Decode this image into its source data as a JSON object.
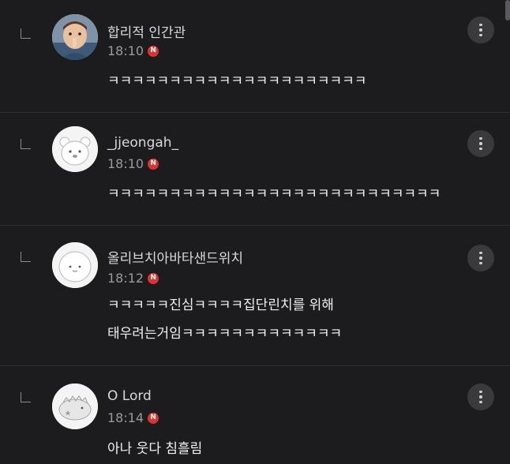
{
  "comments": [
    {
      "nickname": "합리적 인간관",
      "time": "18:10",
      "badge": "N",
      "lines": [
        "ㅋㅋㅋㅋㅋㅋㅋㅋㅋㅋㅋㅋㅋㅋㅋㅋㅋㅋㅋㅋㅋ"
      ],
      "avatar": "child-photo-avatar"
    },
    {
      "nickname": "_jjeongah_",
      "time": "18:10",
      "badge": "N",
      "lines": [
        "ㅋㅋㅋㅋㅋㅋㅋㅋㅋㅋㅋㅋㅋㅋㅋㅋㅋㅋㅋㅋㅋㅋㅋㅋㅋㅋㅋ"
      ],
      "avatar": "bear-avatar"
    },
    {
      "nickname": "올리브치아바타샌드위치",
      "time": "18:12",
      "badge": "N",
      "lines": [
        "ㅋㅋㅋㅋㅋ진심ㅋㅋㅋㅋ집단린치를 위해",
        "태우려는거임ㅋㅋㅋㅋㅋㅋㅋㅋㅋㅋㅋㅋㅋ"
      ],
      "avatar": "bun-avatar"
    },
    {
      "nickname": "O Lord",
      "time": "18:14",
      "badge": "N",
      "lines": [
        "아나 웃다 침흘림"
      ],
      "avatar": "dinosaur-avatar"
    }
  ],
  "colors": {
    "background": "#1c1c1e",
    "badge": "#e0322f",
    "more_button": "#3a3a3c"
  },
  "icons": {
    "reply": "reply-arrow-icon",
    "more": "more-vertical-icon"
  }
}
